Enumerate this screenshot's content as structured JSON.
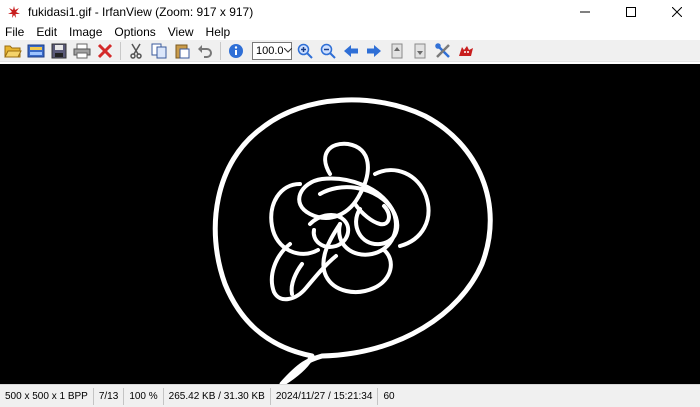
{
  "window": {
    "title": "fukidasi1.gif - IrfanView (Zoom: 917 x 917)",
    "app_icon": "irfanview-red-cat-icon",
    "controls": [
      "minimize-icon",
      "maximize-icon",
      "close-icon"
    ]
  },
  "menu": {
    "items": [
      "File",
      "Edit",
      "Image",
      "Options",
      "View",
      "Help"
    ]
  },
  "toolbar": {
    "buttons": [
      "open-folder-icon",
      "thumbnails-icon",
      "save-icon",
      "print-icon",
      "delete-icon",
      "cut-icon",
      "copy-icon",
      "paste-icon",
      "undo-icon",
      "info-icon",
      "zoom-in-icon",
      "zoom-out-icon",
      "previous-icon",
      "next-icon",
      "page-first-icon",
      "page-last-icon",
      "settings-tools-icon",
      "irfanview-cat-icon"
    ],
    "zoom_value": "100.0"
  },
  "image": {
    "background": "#000000",
    "stroke_color": "#ffffff",
    "description_hidden": "speech bubble with scribble"
  },
  "status": {
    "dimensions": "500 x 500 x 1 BPP",
    "index": "7/13",
    "zoom": "100 %",
    "size": "265.42 KB / 31.30 KB",
    "datetime": "2024/11/27 / 15:21:34",
    "extra": "60"
  },
  "colors": {
    "accent_blue": "#2f6fd6",
    "delete_red": "#d42a2a",
    "folder_yellow": "#e8b530"
  }
}
